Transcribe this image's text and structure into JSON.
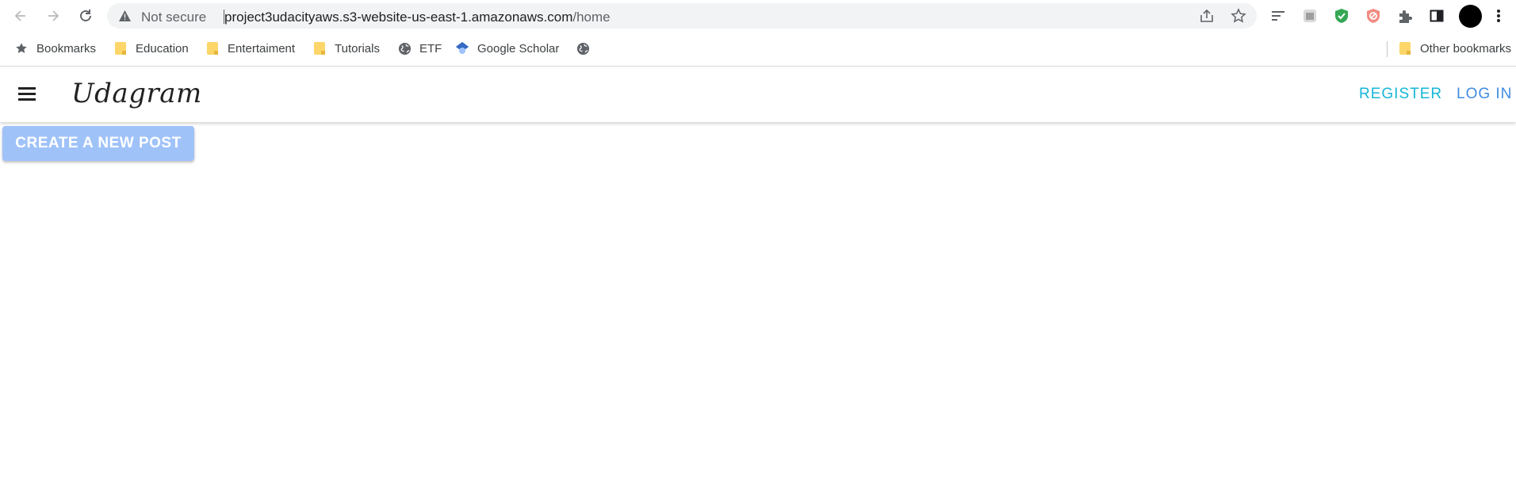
{
  "browser": {
    "security_label": "Not secure",
    "url_host": "project3udacityaws.s3-website-us-east-1.amazonaws.com",
    "url_path": "/home",
    "icons": [
      "back-icon",
      "forward-icon",
      "reload-icon",
      "warning-icon",
      "share-icon",
      "star-icon",
      "tab-search-icon",
      "extension-icon",
      "shield-check-icon",
      "shield-block-icon",
      "puzzle-icon",
      "side-panel-icon",
      "profile-avatar",
      "kebab-menu-icon"
    ]
  },
  "bookmarks": {
    "items": [
      {
        "label": "Bookmarks",
        "icon": "star-icon"
      },
      {
        "label": "Education",
        "icon": "folder-icon"
      },
      {
        "label": "Entertaiment",
        "icon": "folder-icon"
      },
      {
        "label": "Tutorials",
        "icon": "folder-icon"
      },
      {
        "label": "ETF",
        "icon": "globe-icon"
      },
      {
        "label": "Google Scholar",
        "icon": "scholar-icon"
      },
      {
        "label": "",
        "icon": "globe-icon"
      }
    ],
    "other": "Other bookmarks"
  },
  "app": {
    "logo": "Udagram",
    "register_label": "REGISTER",
    "login_label": "LOG IN",
    "create_post_label": "CREATE A NEW POST"
  },
  "colors": {
    "register": "#17b6d8",
    "login": "#3f8ce0",
    "create_button": "#9fc2f9"
  }
}
